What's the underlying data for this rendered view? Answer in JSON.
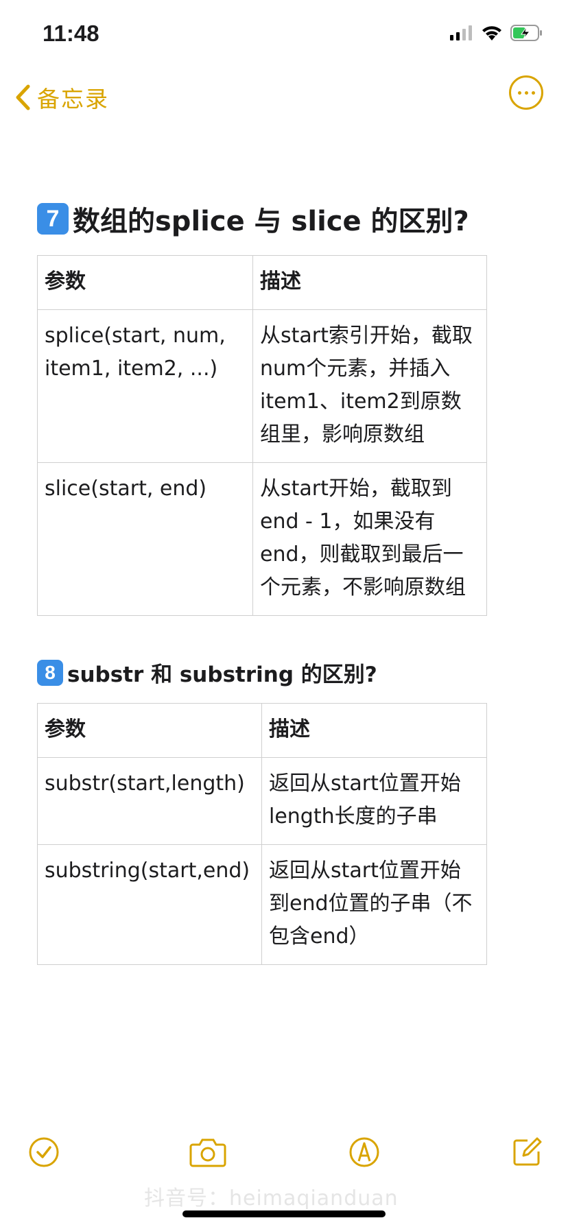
{
  "status": {
    "time": "11:48"
  },
  "nav": {
    "back_label": "备忘录"
  },
  "section7": {
    "number": "7",
    "title": "数组的splice 与 slice 的区别?",
    "headers": [
      "参数",
      "描述"
    ],
    "rows": [
      [
        "splice(start, num, item1, item2, ...)",
        "从start索引开始，截取num个元素，并插入item1、item2到原数组里，影响原数组"
      ],
      [
        "slice(start, end)",
        "从start开始，截取到end - 1，如果没有end，则截取到最后一个元素，不影响原数组"
      ]
    ]
  },
  "section8": {
    "number": "8",
    "title": "substr 和 substring 的区别?",
    "headers": [
      "参数",
      "描述"
    ],
    "rows": [
      [
        "substr(start,length)",
        "返回从start位置开始length长度的子串"
      ],
      [
        "substring(start,end)",
        "返回从start位置开始到end位置的子串（不包含end）"
      ]
    ]
  },
  "watermark": "抖音号：heimaqianduan",
  "colors": {
    "accent": "#d9a400",
    "badge": "#3a8ee6"
  }
}
